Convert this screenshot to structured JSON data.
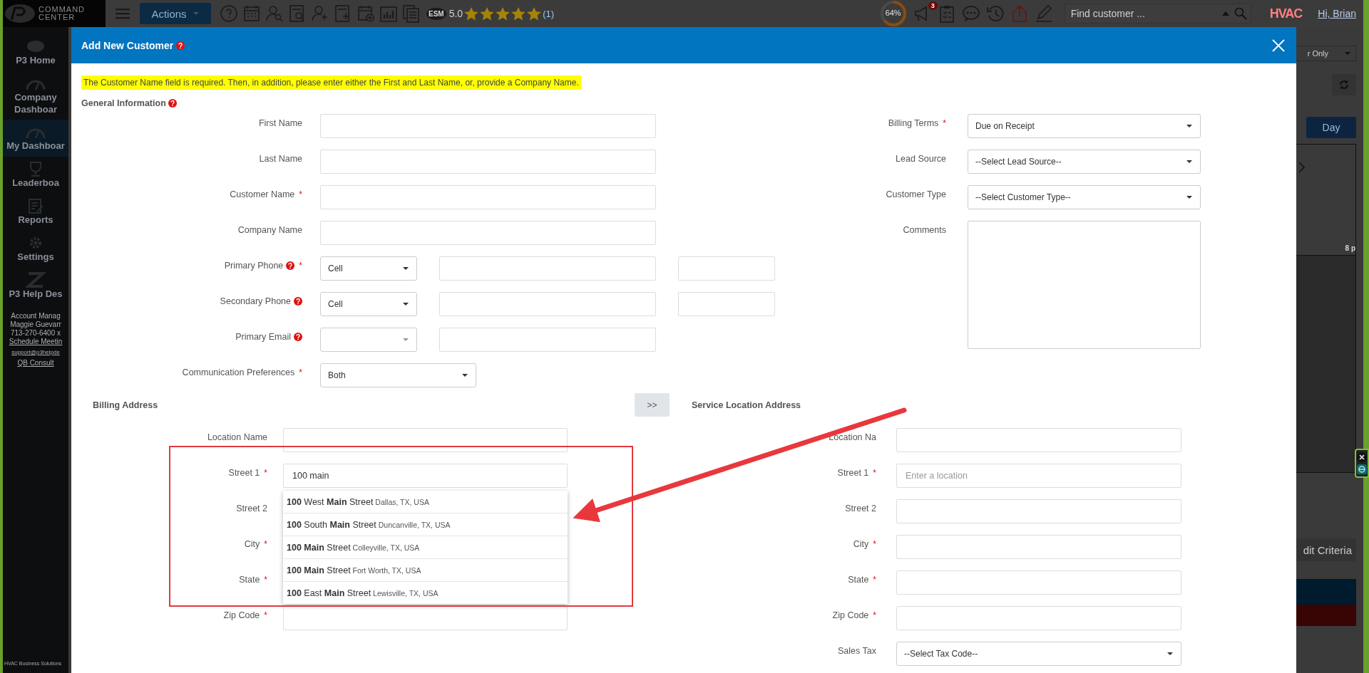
{
  "app_header": {
    "logo_text": [
      "COMMAND",
      "CENTER"
    ],
    "actions_label": "Actions",
    "esm_label": "ESM",
    "rating": "5.0",
    "stars": 5,
    "rating_count": "(1)",
    "score": {
      "text": "64%",
      "level": 0.64
    },
    "notification_count": "3",
    "search": {
      "placeholder": "Find customer ..."
    },
    "brand_logo": "HVAC",
    "greeting": "Hi, Brian"
  },
  "sidebar": {
    "items": [
      {
        "label": "P3 Home",
        "selected": false
      },
      {
        "label": "Company Dashboar",
        "selected": false
      },
      {
        "label": "My Dashboar",
        "selected": true
      },
      {
        "label": "Leaderboa",
        "selected": false
      },
      {
        "label": "Reports",
        "selected": false
      },
      {
        "label": "Settings",
        "selected": false
      },
      {
        "label": "P3 Help Des",
        "selected": false
      }
    ],
    "account_lines": [
      "Account Manag",
      "Maggie Guevarr",
      "713-270-6400 x"
    ],
    "links": [
      "Schedule Meetin",
      "support@p3helpde",
      "QB Consult"
    ],
    "footer": "HVAC Business Solutions"
  },
  "background_panel": {
    "filter_label": "r Only",
    "day_button": "Day",
    "time_label": "8 p",
    "criteria_button": "dit Criteria"
  },
  "modal": {
    "title": "Add New Customer",
    "title_help": true,
    "required_mark": "*",
    "notice": "The Customer Name field is required. Then, in addition, please enter either the First and Last Name, or, provide a Company Name.",
    "general": {
      "title": "General Information",
      "help": true,
      "left_fields": [
        {
          "label": "First Name",
          "kind": "text",
          "required": false
        },
        {
          "label": "Last Name",
          "kind": "text",
          "required": false
        },
        {
          "label": "Customer Name",
          "kind": "text",
          "required": true
        },
        {
          "label": "Company Name",
          "kind": "text",
          "required": false
        },
        {
          "label": "Primary Phone",
          "kind": "phone",
          "required": true,
          "help": true,
          "type_value": "Cell"
        },
        {
          "label": "Secondary Phone",
          "kind": "phone",
          "required": false,
          "help": true,
          "type_value": "Cell"
        },
        {
          "label": "Primary Email",
          "kind": "email",
          "required": false,
          "help": true
        },
        {
          "label": "Communication Preferences",
          "kind": "select",
          "required": true,
          "value": "Both"
        }
      ],
      "right_fields": [
        {
          "label": "Billing Terms",
          "kind": "select",
          "required": true,
          "value": "Due on Receipt"
        },
        {
          "label": "Lead Source",
          "kind": "select",
          "required": false,
          "value": "--Select Lead Source--"
        },
        {
          "label": "Customer Type",
          "kind": "select",
          "required": false,
          "value": "--Select Customer Type--"
        },
        {
          "label": "Comments",
          "kind": "textarea",
          "required": false
        }
      ]
    },
    "billing": {
      "title": "Billing Address",
      "fields": [
        {
          "label": "Location Name",
          "kind": "text",
          "required": false
        },
        {
          "label": "Street 1",
          "kind": "text",
          "required": true,
          "value": "100 main"
        },
        {
          "label": "Street 2",
          "kind": "text",
          "required": false
        },
        {
          "label": "City",
          "kind": "text",
          "required": true
        },
        {
          "label": "State",
          "kind": "text",
          "required": true
        },
        {
          "label": "Zip Code",
          "kind": "text",
          "required": true
        }
      ]
    },
    "copy_button": ">>",
    "service": {
      "title": "Service Location Address",
      "fields": [
        {
          "label": "Location Na",
          "kind": "text",
          "required": false
        },
        {
          "label": "Street 1",
          "kind": "text",
          "required": true,
          "placeholder": "Enter a location"
        },
        {
          "label": "Street 2",
          "kind": "text",
          "required": false
        },
        {
          "label": "City",
          "kind": "text",
          "required": true
        },
        {
          "label": "State",
          "kind": "text",
          "required": true
        },
        {
          "label": "Zip Code",
          "kind": "text",
          "required": true
        },
        {
          "label": "Sales Tax",
          "kind": "select",
          "required": false,
          "value": "--Select Tax Code--"
        }
      ]
    },
    "suggestions": [
      {
        "street": "**100** West **Main** Street",
        "locality": "Dallas, TX, USA"
      },
      {
        "street": "**100** South **Main** Street",
        "locality": "Duncanville, TX, USA"
      },
      {
        "street": "**100** **Main** Street",
        "locality": "Colleyville, TX, USA"
      },
      {
        "street": "**100** **Main** Street",
        "locality": "Fort Worth, TX, USA"
      },
      {
        "street": "**100** East **Main** Street",
        "locality": "Lewisville, TX, USA"
      }
    ]
  }
}
